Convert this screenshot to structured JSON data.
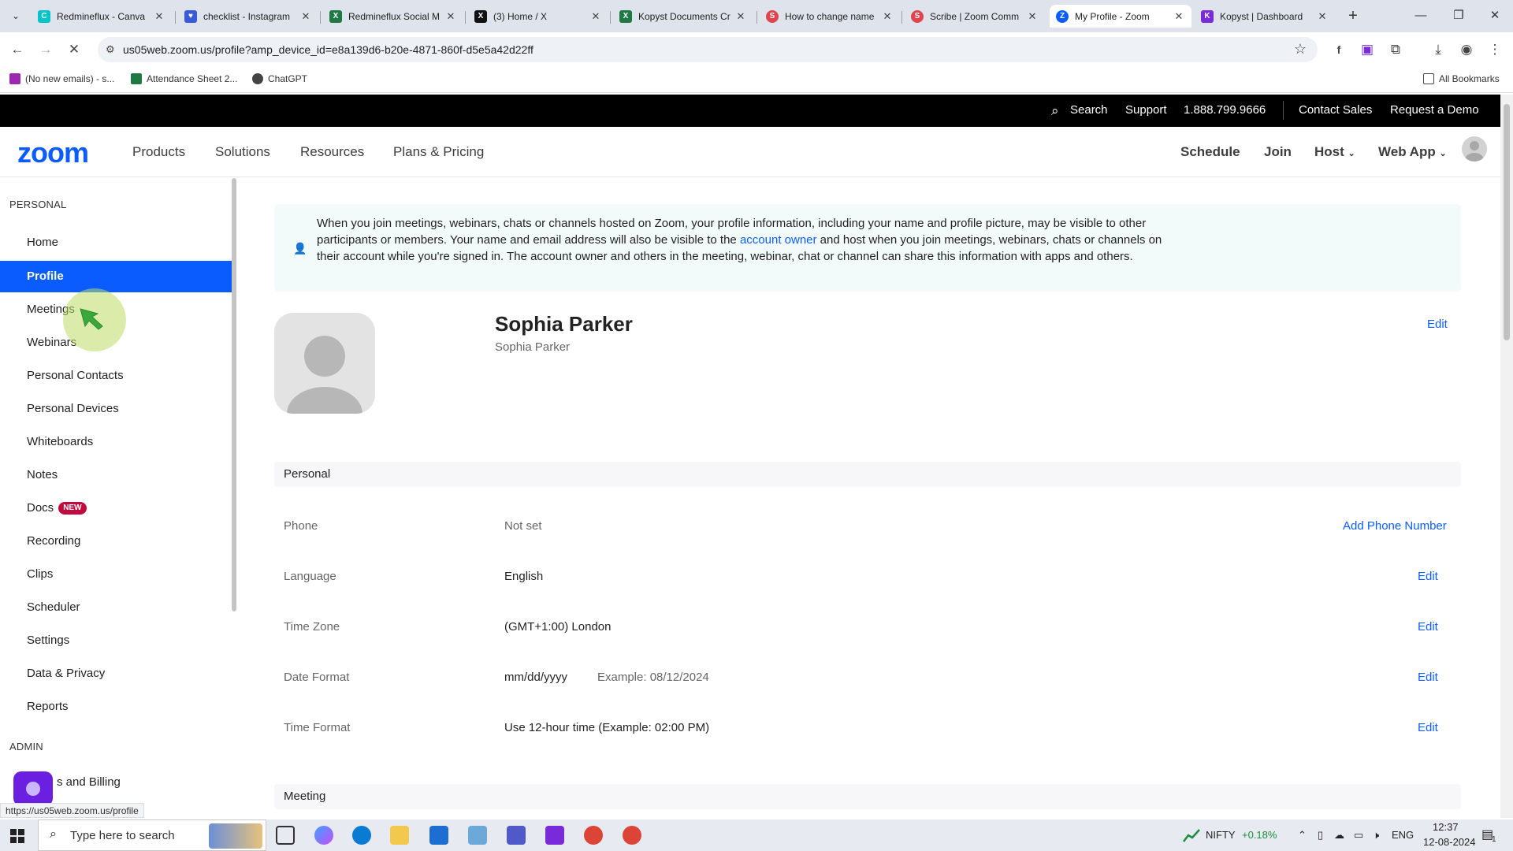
{
  "browser": {
    "tabs": [
      {
        "title": "Redmineflux - Canva",
        "color": "#00c4cc",
        "glyph": "C"
      },
      {
        "title": "checklist - Instagram",
        "color": "#3a5bd9",
        "glyph": "♥"
      },
      {
        "title": "Redmineflux Social M",
        "color": "#1d7a43",
        "glyph": "X"
      },
      {
        "title": "(3) Home / X",
        "color": "#111111",
        "glyph": "X"
      },
      {
        "title": "Kopyst Documents Cr",
        "color": "#1d7a43",
        "glyph": "X"
      },
      {
        "title": "How to change name",
        "color": "#e0444e",
        "glyph": "S"
      },
      {
        "title": "Scribe | Zoom Comm",
        "color": "#e0444e",
        "glyph": "S"
      },
      {
        "title": "My Profile - Zoom",
        "color": "#0b5cff",
        "glyph": "Z"
      },
      {
        "title": "Kopyst | Dashboard",
        "color": "#7a2bd9",
        "glyph": "K"
      }
    ],
    "url": "us05web.zoom.us/profile?amp_device_id=e8a139d6-b20e-4871-860f-d5e5a42d22ff",
    "bookmarks": [
      {
        "label": "(No new emails) - s...",
        "color": "#9c27b0"
      },
      {
        "label": "Attendance Sheet 2...",
        "color": "#1d7a43"
      },
      {
        "label": "ChatGPT",
        "color": "#444444"
      }
    ],
    "all_bookmarks": "All Bookmarks",
    "status_url": "https://us05web.zoom.us/profile"
  },
  "topbar": {
    "search": "Search",
    "support": "Support",
    "phone": "1.888.799.9666",
    "contact_sales": "Contact Sales",
    "request_demo": "Request a Demo"
  },
  "nav": {
    "logo": "zoom",
    "items": [
      "Products",
      "Solutions",
      "Resources",
      "Plans & Pricing"
    ],
    "right": {
      "schedule": "Schedule",
      "join": "Join",
      "host": "Host",
      "web_app": "Web App"
    }
  },
  "sidebar": {
    "personal_label": "PERSONAL",
    "items": [
      {
        "label": "Home"
      },
      {
        "label": "Profile"
      },
      {
        "label": "Meetings"
      },
      {
        "label": "Webinars"
      },
      {
        "label": "Personal Contacts"
      },
      {
        "label": "Personal Devices"
      },
      {
        "label": "Whiteboards"
      },
      {
        "label": "Notes"
      },
      {
        "label": "Docs",
        "badge": "NEW"
      },
      {
        "label": "Recording"
      },
      {
        "label": "Clips"
      },
      {
        "label": "Scheduler"
      },
      {
        "label": "Settings"
      },
      {
        "label": "Data & Privacy"
      },
      {
        "label": "Reports"
      }
    ],
    "admin_label": "ADMIN",
    "admin_item": "s and Billing"
  },
  "notice": {
    "part1": "When you join meetings, webinars, chats or channels hosted on Zoom, your profile information, including your name and profile picture, may be visible to other participants or members. Your name and email address will also be visible to the ",
    "link": "account owner",
    "part2": " and host when you join meetings, webinars, chats or channels on their account while you're signed in. The account owner and others in the meeting, webinar, chat or channel can share this information with apps and others."
  },
  "profile": {
    "name": "Sophia Parker",
    "display_name": "Sophia Parker",
    "edit": "Edit"
  },
  "personal": {
    "title": "Personal",
    "rows": [
      {
        "label": "Phone",
        "value": "Not set",
        "hint": "",
        "action": "Add Phone Number"
      },
      {
        "label": "Language",
        "value": "English",
        "hint": "",
        "action": "Edit"
      },
      {
        "label": "Time Zone",
        "value": "(GMT+1:00) London",
        "hint": "",
        "action": "Edit"
      },
      {
        "label": "Date Format",
        "value": "mm/dd/yyyy",
        "hint": "Example: 08/12/2024",
        "action": "Edit"
      },
      {
        "label": "Time Format",
        "value": "Use 12-hour time (Example: 02:00 PM)",
        "hint": "",
        "action": "Edit"
      }
    ]
  },
  "meeting": {
    "title": "Meeting"
  },
  "taskbar": {
    "search_placeholder": "Type here to search",
    "nifty": "NIFTY",
    "nifty_change": "+0.18%",
    "lang": "ENG",
    "time": "12:37",
    "date": "12-08-2024",
    "notif_count": "1"
  },
  "colors": {
    "accent": "#0b5cff",
    "badge": "#c20a3e",
    "gain": "#1d8c3a"
  }
}
